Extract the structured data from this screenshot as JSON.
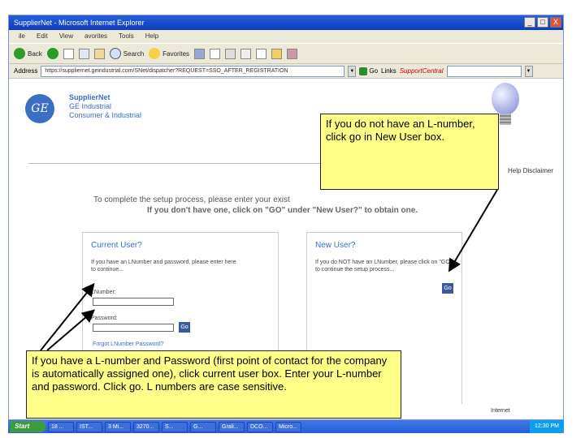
{
  "window": {
    "title": "SupplierNet - Microsoft Internet Explorer",
    "controls": [
      "_",
      "□",
      "X"
    ]
  },
  "menu": [
    "ile",
    "Edit",
    "View",
    "avorites",
    "Tools",
    "Help"
  ],
  "toolbar": {
    "back": "Back",
    "search": "Search",
    "favorites": "Favorites"
  },
  "address": {
    "label": "Address",
    "url": "https://suppliernet.geindustrial.com/SNet/dispatcher?REQUEST=SSO_AFTER_REGISTRATION",
    "go": "Go",
    "links": "Links",
    "support_link": "SupportCentral"
  },
  "page": {
    "brand_line1": "SupplierNet",
    "brand_line2": "GE Industrial",
    "brand_line3": "Consumer & Industrial",
    "logo": "GE",
    "help_links": "Help  Disclaimer",
    "instruction_line1": "To complete the setup process, please enter your exist",
    "instruction_line2": "If you don't have one, click on \"GO\" under \"New User?\" to obtain one.",
    "current_user": {
      "title": "Current User?",
      "text": "If you have an LNumber and password, please enter here to continue...",
      "lnumber_label": "LNumber:",
      "password_label": "Password:",
      "go": "Go",
      "forgot": "Forgot LNumber Password?"
    },
    "new_user": {
      "title": "New User?",
      "text": "If you do NOT have an LNumber, please click on \"GO\" to continue the setup process...",
      "go": "Go"
    }
  },
  "callouts": {
    "top": "If you do not have an L-number, click go in New User box.",
    "bottom": "If you have a L-number and Password (first point of contact for the company is automatically assigned one), click current user box. Enter your L-number and password. Click go. L numbers are case sensitive."
  },
  "taskbar": {
    "start": "Start",
    "items": [
      "18 ...",
      "IST...",
      "3 Mi...",
      "3270...",
      "S...",
      "G...",
      "Grali...",
      "DCO...",
      "Micro..."
    ],
    "tray_time": "12:30 PM",
    "internet_label": "Internet"
  },
  "colors": {
    "accent_blue": "#3a6fc4",
    "callout_yellow": "#ffff88",
    "titlebar_blue": "#0a3cbf"
  }
}
